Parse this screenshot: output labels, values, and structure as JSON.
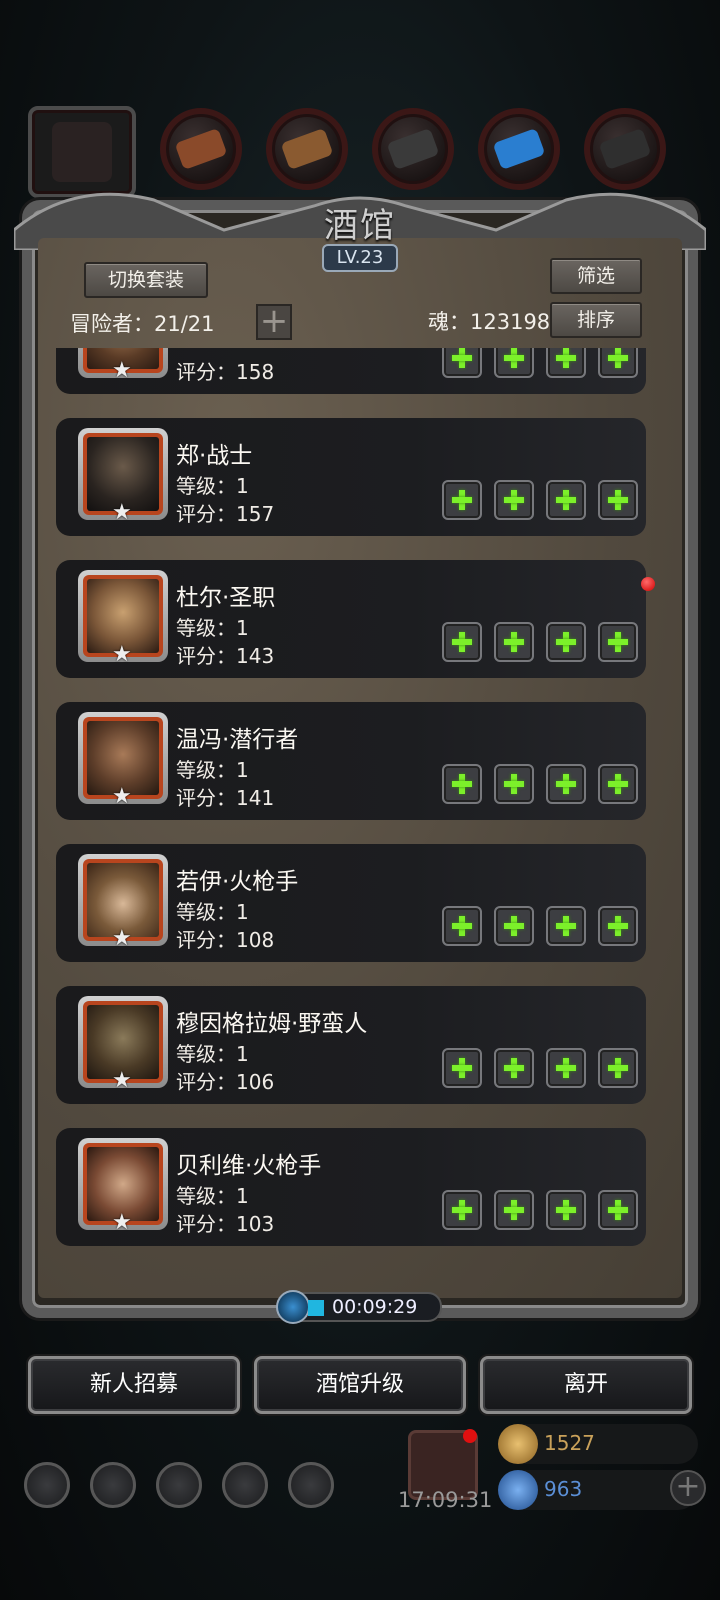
{
  "app": {
    "title": "酒馆",
    "level_badge": "LV.23"
  },
  "header": {
    "switch_outfit_label": "切换套装",
    "filter_label": "筛选",
    "sort_label": "排序",
    "adventurers_label": "冒险者：21/21",
    "souls_label": "魂：123198"
  },
  "heroes": [
    {
      "name": "",
      "level": "",
      "score": "评分：158"
    },
    {
      "name": "郑·战士",
      "level": "等级：1",
      "score": "评分：157"
    },
    {
      "name": "杜尔·圣职",
      "level": "等级：1",
      "score": "评分：143"
    },
    {
      "name": "温冯·潜行者",
      "level": "等级：1",
      "score": "评分：141"
    },
    {
      "name": "若伊·火枪手",
      "level": "等级：1",
      "score": "评分：108"
    },
    {
      "name": "穆因格拉姆·野蛮人",
      "level": "等级：1",
      "score": "评分：106"
    },
    {
      "name": "贝利维·火枪手",
      "level": "等级：1",
      "score": "评分：103"
    }
  ],
  "timer": {
    "value": "00:09:29"
  },
  "actions": {
    "recruit_label": "新人招募",
    "upgrade_label": "酒馆升级",
    "leave_label": "离开"
  },
  "footer": {
    "clock": "17:09:31",
    "gold": "1527",
    "gems": "963"
  },
  "colors": {
    "plus_green": "#7cf02a",
    "portrait_border": "#b8451e",
    "gold_text": "#c9a15a",
    "gem_text": "#5b8fd6"
  }
}
